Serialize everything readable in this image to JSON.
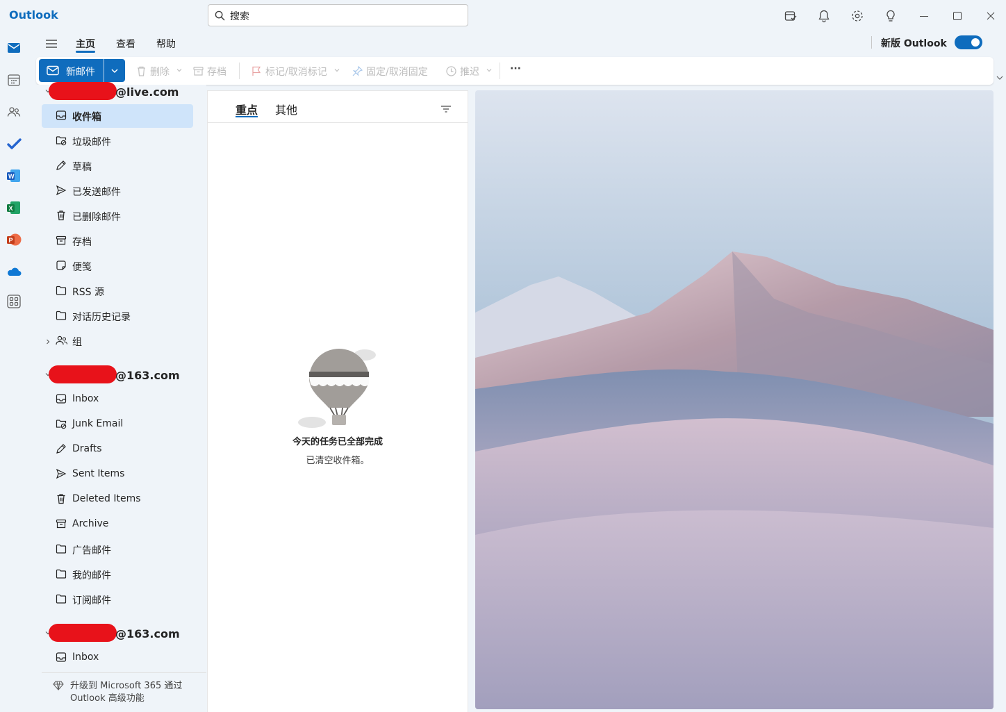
{
  "app": {
    "title": "Outlook"
  },
  "search": {
    "placeholder": "搜索"
  },
  "ribbon": {
    "tabs": [
      "主页",
      "查看",
      "帮助"
    ],
    "new_outlook_label": "新版 Outlook",
    "new_outlook_enabled": true
  },
  "toolbar": {
    "new_mail": "新邮件",
    "delete": "删除",
    "archive": "存档",
    "flag": "标记/取消标记",
    "pin": "固定/取消固定",
    "snooze": "推迟",
    "more": "···"
  },
  "accounts": [
    {
      "email_suffix": "@live.com",
      "folders": [
        {
          "label": "收件箱",
          "icon": "inbox-icon",
          "selected": true
        },
        {
          "label": "垃圾邮件",
          "icon": "junk-icon"
        },
        {
          "label": "草稿",
          "icon": "drafts-icon"
        },
        {
          "label": "已发送邮件",
          "icon": "send-icon"
        },
        {
          "label": "已删除邮件",
          "icon": "trash-icon"
        },
        {
          "label": "存档",
          "icon": "archive-icon"
        },
        {
          "label": "便笺",
          "icon": "note-icon"
        },
        {
          "label": "RSS 源",
          "icon": "folder-icon"
        },
        {
          "label": "对话历史记录",
          "icon": "folder-icon"
        },
        {
          "label": "组",
          "icon": "groups-icon"
        }
      ]
    },
    {
      "email_suffix": "@163.com",
      "folders": [
        {
          "label": "Inbox",
          "icon": "inbox-icon"
        },
        {
          "label": "Junk Email",
          "icon": "junk-icon"
        },
        {
          "label": "Drafts",
          "icon": "drafts-icon"
        },
        {
          "label": "Sent Items",
          "icon": "send-icon"
        },
        {
          "label": "Deleted Items",
          "icon": "trash-icon"
        },
        {
          "label": "Archive",
          "icon": "archive-icon"
        },
        {
          "label": "广告邮件",
          "icon": "folder-icon"
        },
        {
          "label": "我的邮件",
          "icon": "folder-icon"
        },
        {
          "label": "订阅邮件",
          "icon": "folder-icon"
        }
      ]
    },
    {
      "email_suffix": "@163.com",
      "folders": [
        {
          "label": "Inbox",
          "icon": "inbox-icon"
        }
      ]
    }
  ],
  "upgrade": {
    "text": "升级到 Microsoft 365 通过 Outlook 高级功能"
  },
  "message_list": {
    "tabs": [
      "重点",
      "其他"
    ],
    "empty_title": "今天的任务已全部完成",
    "empty_subtitle": "已清空收件箱。"
  },
  "colors": {
    "accent": "#0f6cbd",
    "selected_folder": "#cfe4fa",
    "background": "#eff4f9"
  }
}
